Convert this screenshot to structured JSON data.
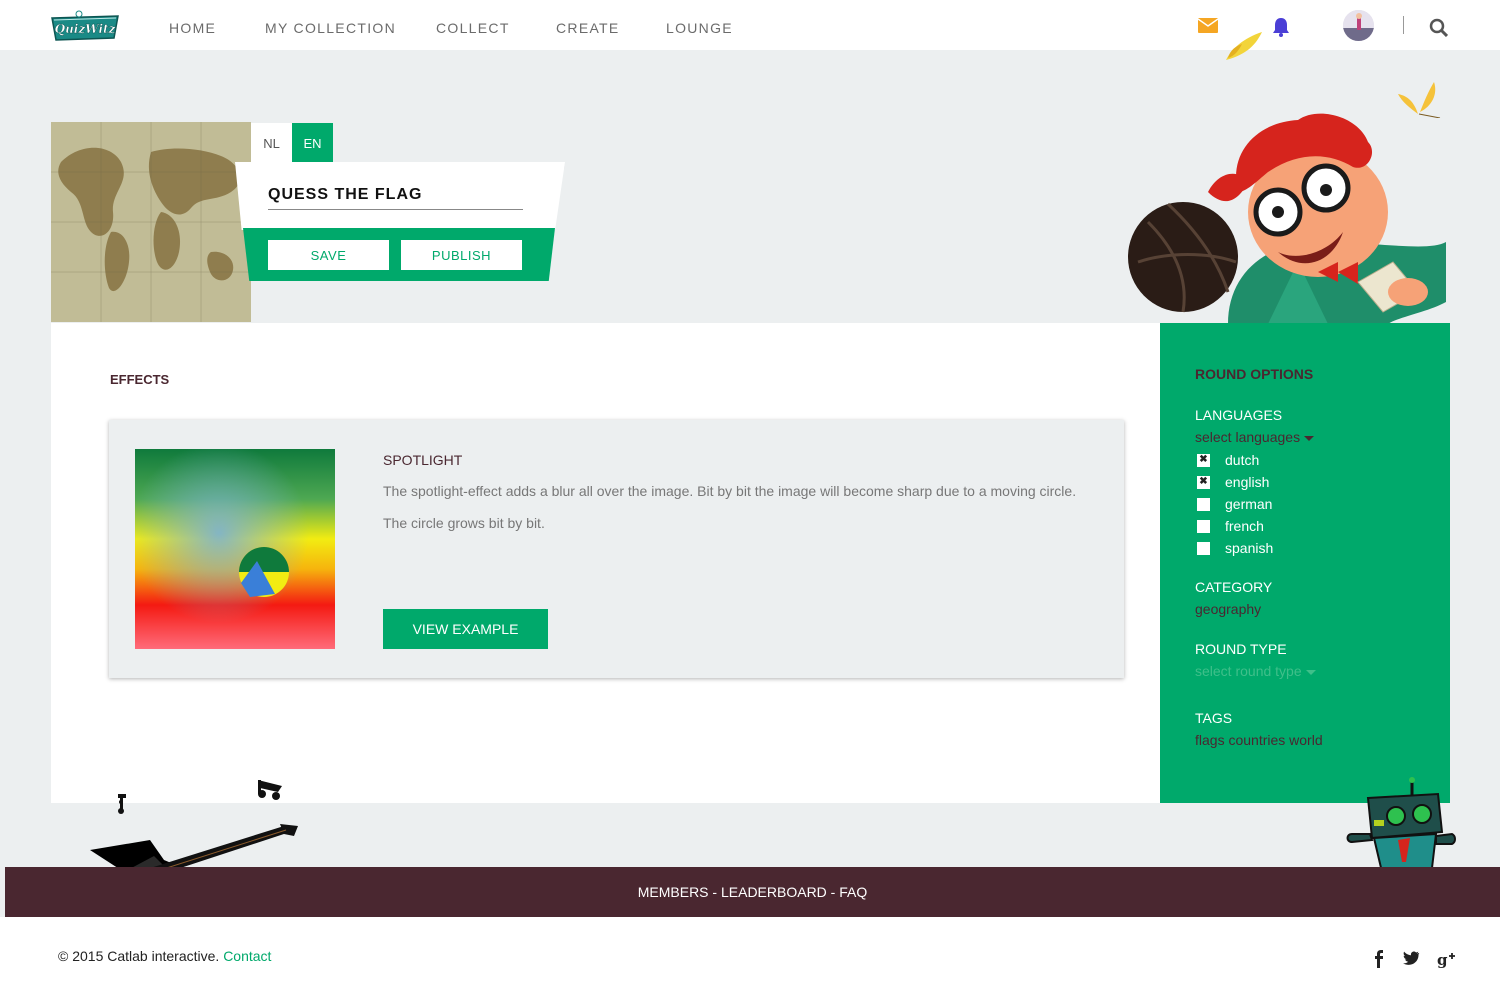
{
  "brand": {
    "logo_text": "QuizWitz"
  },
  "nav": {
    "items": [
      {
        "label": "HOME"
      },
      {
        "label": "MY COLLECTION"
      },
      {
        "label": "COLLECT"
      },
      {
        "label": "CREATE"
      },
      {
        "label": "LOUNGE"
      }
    ],
    "icons": [
      "mail-icon",
      "bell-icon",
      "avatar",
      "search-icon"
    ]
  },
  "quiz": {
    "languages": [
      "NL",
      "EN"
    ],
    "active_language": "EN",
    "title_value": "QUESS THE FLAG",
    "save_label": "SAVE",
    "publish_label": "PUBLISH"
  },
  "effects": {
    "section_title": "EFFECTS",
    "card": {
      "name": "SPOTLIGHT",
      "description": "The spotlight-effect adds a blur all over the image. Bit by bit the image will become sharp due to a moving circle. The circle grows bit by bit.",
      "button_label": "VIEW EXAMPLE"
    }
  },
  "round_options": {
    "heading": "ROUND OPTIONS",
    "languages_label": "LANGUAGES",
    "languages_select": "select languages",
    "language_options": [
      {
        "label": "dutch",
        "checked": true
      },
      {
        "label": "english",
        "checked": true
      },
      {
        "label": "german",
        "checked": false
      },
      {
        "label": "french",
        "checked": false
      },
      {
        "label": "spanish",
        "checked": false
      }
    ],
    "category_label": "CATEGORY",
    "category_value": "geography",
    "round_type_label": "ROUND TYPE",
    "round_type_select": "select round type",
    "tags_label": "TAGS",
    "tags_value": "flags countries world"
  },
  "footer": {
    "links": [
      "MEMBERS",
      "LEADERBOARD",
      "FAQ"
    ],
    "separator": " - ",
    "copyright": "© 2015 Catlab interactive.",
    "contact_label": "Contact",
    "social_icons": [
      "facebook-icon",
      "twitter-icon",
      "google-plus-icon"
    ]
  },
  "colors": {
    "accent": "#00a96b",
    "brand_dark": "#4a2730",
    "background": "#eceff0"
  }
}
